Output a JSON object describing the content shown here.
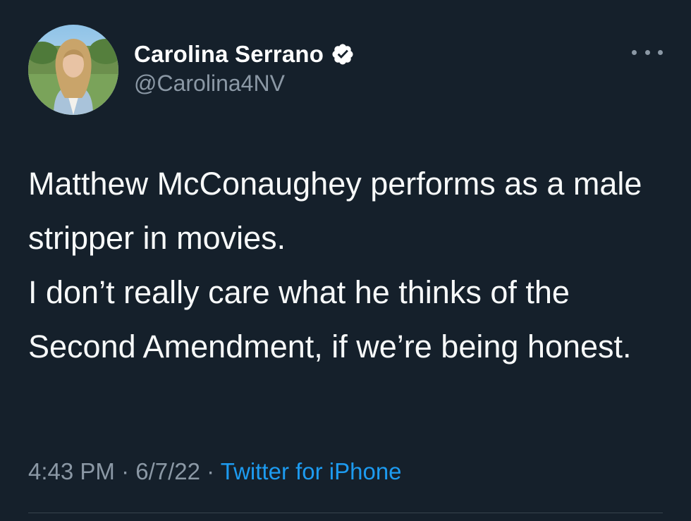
{
  "author": {
    "display_name": "Carolina Serrano",
    "handle": "@Carolina4NV",
    "verified": true,
    "avatar_icon": "profile-photo"
  },
  "tweet": {
    "paragraphs": [
      "Matthew McConaughey performs as a male stripper in movies.",
      "I don’t really care what he thinks of the Second Amendment, if we’re being honest."
    ],
    "time": "4:43 PM",
    "date": "6/7/22",
    "separator": "·",
    "source": "Twitter for iPhone"
  },
  "colors": {
    "background": "#15202b",
    "text": "#f7f9f9",
    "secondary": "#8b98a5",
    "link": "#1d9bf0"
  }
}
